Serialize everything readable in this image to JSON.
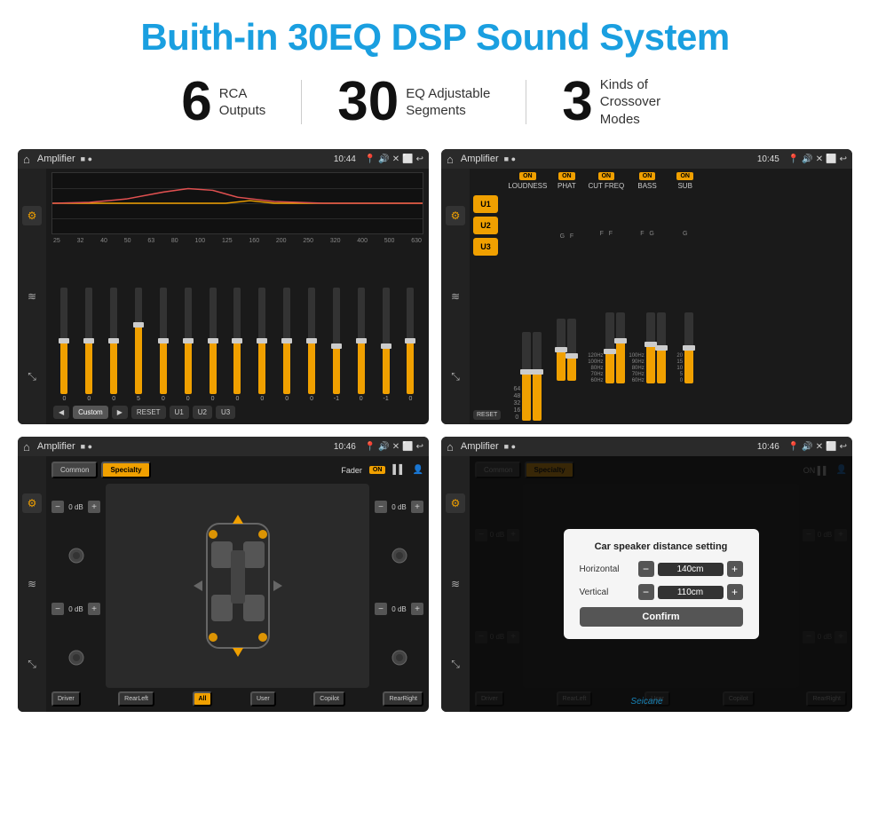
{
  "page": {
    "title": "Buith-in 30EQ DSP Sound System",
    "watermark": "Seicane"
  },
  "stats": [
    {
      "number": "6",
      "label": "RCA\nOutputs"
    },
    {
      "number": "30",
      "label": "EQ Adjustable\nSegments"
    },
    {
      "number": "3",
      "label": "Kinds of\nCrossover Modes"
    }
  ],
  "screen1": {
    "status_title": "Amplifier",
    "time": "10:44",
    "eq_freqs": [
      "25",
      "32",
      "40",
      "50",
      "63",
      "80",
      "100",
      "125",
      "160",
      "200",
      "250",
      "320",
      "400",
      "500",
      "630"
    ],
    "eq_values": [
      "0",
      "0",
      "0",
      "5",
      "0",
      "0",
      "0",
      "0",
      "0",
      "0",
      "0",
      "-1",
      "0",
      "-1"
    ],
    "bottom_btns": [
      "Custom",
      "RESET",
      "U1",
      "U2",
      "U3"
    ]
  },
  "screen2": {
    "status_title": "Amplifier",
    "time": "10:45",
    "presets": [
      "U1",
      "U2",
      "U3"
    ],
    "sections": [
      {
        "label": "LOUDNESS",
        "on": true
      },
      {
        "label": "PHAT",
        "on": true
      },
      {
        "label": "CUT FREQ",
        "on": true
      },
      {
        "label": "BASS",
        "on": true
      },
      {
        "label": "SUB",
        "on": true
      }
    ],
    "reset_btn": "RESET"
  },
  "screen3": {
    "status_title": "Amplifier",
    "time": "10:46",
    "tabs": [
      "Common",
      "Specialty"
    ],
    "active_tab": "Specialty",
    "fader_label": "Fader",
    "on_badge": "ON",
    "controls": [
      {
        "label": "0 dB"
      },
      {
        "label": "0 dB"
      },
      {
        "label": "0 dB"
      },
      {
        "label": "0 dB"
      }
    ],
    "bottom_btns": [
      "Driver",
      "RearLeft",
      "All",
      "User",
      "Copilot",
      "RearRight"
    ],
    "all_active": true
  },
  "screen4": {
    "status_title": "Amplifier",
    "time": "10:46",
    "dialog": {
      "title": "Car speaker distance setting",
      "horizontal_label": "Horizontal",
      "horizontal_value": "140cm",
      "vertical_label": "Vertical",
      "vertical_value": "110cm",
      "confirm_btn": "Confirm"
    },
    "bottom_btns": [
      "Driver",
      "RearLeft",
      "All",
      "User",
      "Copilot",
      "RearRight"
    ]
  }
}
